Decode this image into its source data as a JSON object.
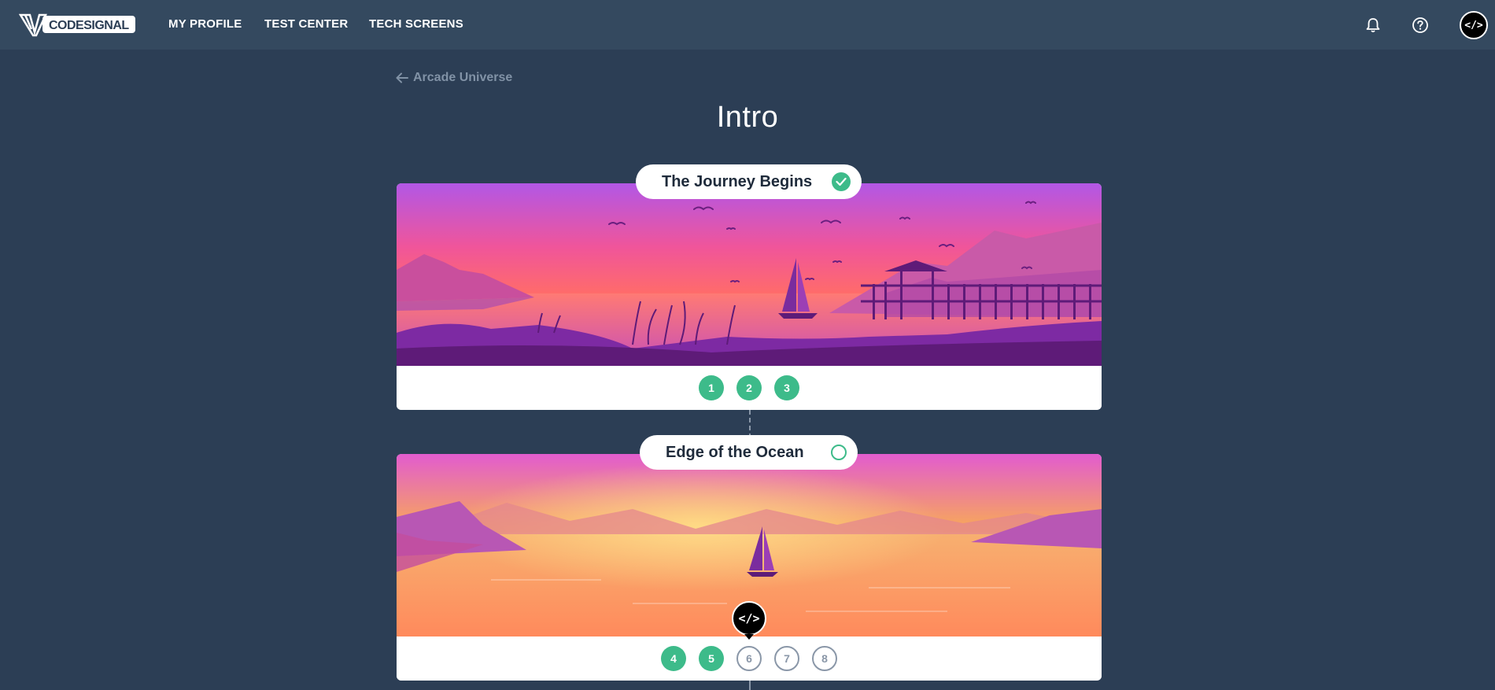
{
  "nav": {
    "logo_text": "CODESIGNAL",
    "links": [
      "MY PROFILE",
      "TEST CENTER",
      "TECH SCREENS"
    ],
    "icons": [
      "bell-icon",
      "help-icon"
    ],
    "avatar_text": "</>"
  },
  "breadcrumb": {
    "back_label": "Arcade Universe"
  },
  "page": {
    "title": "Intro"
  },
  "worlds": [
    {
      "title": "The Journey Begins",
      "status": "completed",
      "levels": [
        {
          "label": "1",
          "state": "done"
        },
        {
          "label": "2",
          "state": "done"
        },
        {
          "label": "3",
          "state": "done"
        }
      ]
    },
    {
      "title": "Edge of the Ocean",
      "status": "in-progress",
      "current_marker": "</>",
      "levels": [
        {
          "label": "4",
          "state": "done"
        },
        {
          "label": "5",
          "state": "done"
        },
        {
          "label": "6",
          "state": "todo"
        },
        {
          "label": "7",
          "state": "todo"
        },
        {
          "label": "8",
          "state": "todo"
        }
      ]
    }
  ],
  "colors": {
    "background": "#2c3e55",
    "topbar": "#34495f",
    "accent_green": "#3dbb8a",
    "muted": "#8a97a8"
  }
}
